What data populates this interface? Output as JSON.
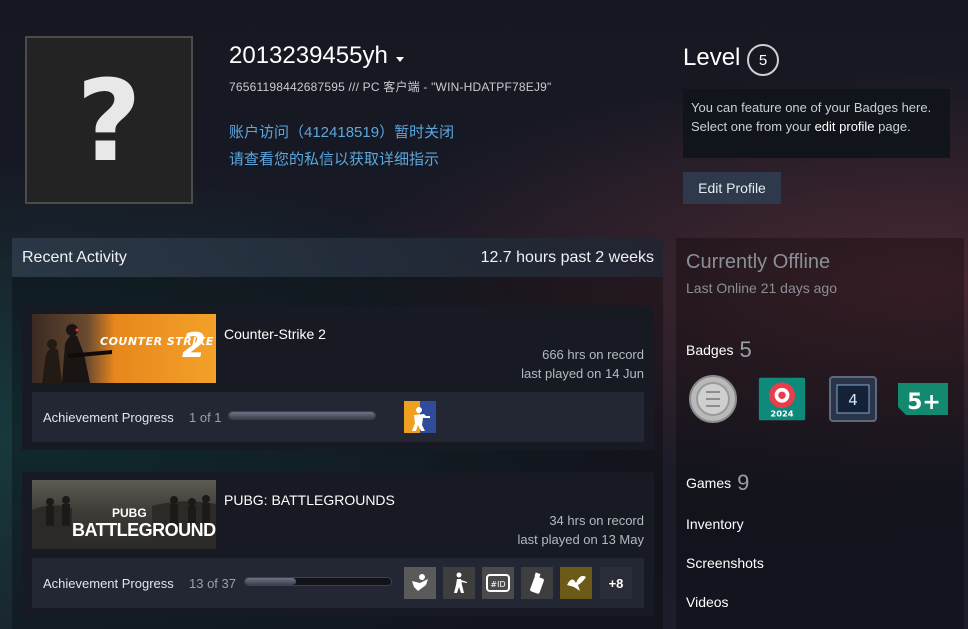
{
  "profile": {
    "persona_name": "2013239455yh",
    "steam_info": "76561198442687595 /// PC 客户端 - \"WIN-HDATPF78EJ9\"",
    "ban_line1": "账户访问（412418519）暂时关闭",
    "ban_line2": "请查看您的私信以获取详细指示",
    "avatar_glyph": "?"
  },
  "level": {
    "label": "Level",
    "value": "5",
    "hint_part1": "You can feature one of your Badges here. Select one from your ",
    "hint_link": "edit profile",
    "hint_part2": " page.",
    "edit_button": "Edit Profile"
  },
  "recent_activity": {
    "title": "Recent Activity",
    "hours": "12.7 hours past 2 weeks",
    "games": [
      {
        "name": "Counter-Strike 2",
        "capsule_text": "COUNTER STRIKE",
        "capsule_number": "2",
        "hours_on_record": "666 hrs on record",
        "last_played": "last played on 14 Jun",
        "achievement_label": "Achievement Progress",
        "achievement_count": "1 of 1",
        "progress": 1.0
      },
      {
        "name": "PUBG: BATTLEGROUNDS",
        "capsule_text_top": "PUBG",
        "capsule_text": "BATTLEGROUNDS",
        "hours_on_record": "34 hrs on record",
        "last_played": "last played on 13 May",
        "achievement_label": "Achievement Progress",
        "achievement_count": "13 of 37",
        "progress": 0.35,
        "more_achievements": "+8"
      }
    ]
  },
  "sidebar": {
    "status": "Currently Offline",
    "last_online": "Last Online 21 days ago",
    "badges_label": "Badges",
    "badges_count": "5",
    "badge_2024_text": "2024",
    "badge_level_text": "4",
    "badge_years_text": "5+",
    "games_label": "Games",
    "games_count": "9",
    "inventory": "Inventory",
    "screenshots": "Screenshots",
    "videos": "Videos"
  },
  "colors": {
    "link_blue": "#5ca7dd",
    "cs2_orange": "#f0951e",
    "badge_teal": "#0e8a7a"
  }
}
